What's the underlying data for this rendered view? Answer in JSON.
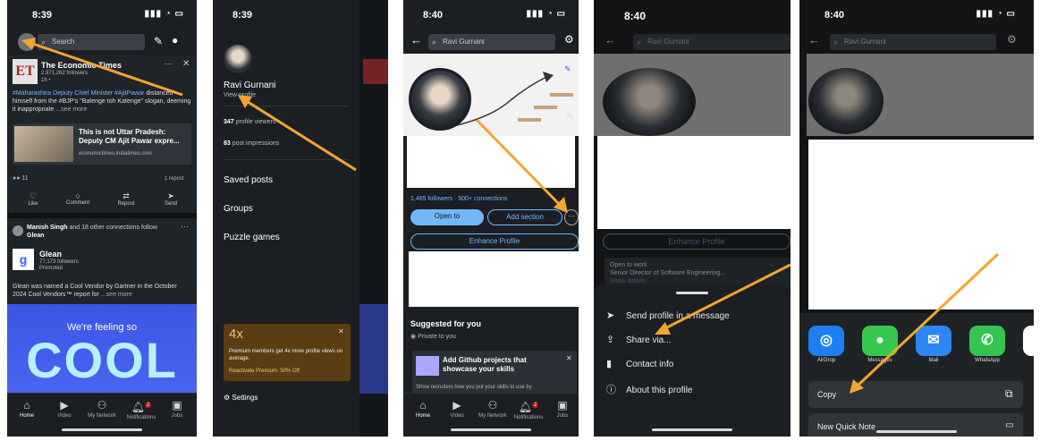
{
  "colors": {
    "bg": "#1b1f23",
    "accent": "#71b7fb",
    "arrow": "#f5a52a",
    "premium": "#5a3d12"
  },
  "s1": {
    "time": "8:39",
    "search_placeholder": "Search",
    "post1": {
      "source": "The Economic Times",
      "followers": "2,971,262 followers",
      "age": "1h •",
      "text_tags": "#Maharashtra Deputy Chief Minister #AjitPawar",
      "text_rest": "distanced himself from the #BJP's \"Batenge toh Katenge\" slogan, deeming it inappropriate",
      "more": "...see more",
      "link_title": "This is not Uttar Pradesh: Deputy CM Ajit Pawar expre...",
      "link_url": "economictimes.indiatimes.com",
      "reactions": "11",
      "reposts": "1 repost"
    },
    "actions": [
      "Like",
      "Comment",
      "Repost",
      "Send"
    ],
    "post2": {
      "header_name": "Manish Singh",
      "header_rest": "and 18 other connections follow",
      "header_company": "Glean",
      "company": "Glean",
      "followers": "77,173 followers",
      "promoted": "Promoted",
      "text": "Glean was named a Cool Vendor by Gartner in the October 2024 Cool Vendors™ report for",
      "more": "...see more",
      "banner_line1": "We're feeling so",
      "banner_line2": "COOL"
    },
    "nav": [
      "Home",
      "Video",
      "My Network",
      "Notifications",
      "Jobs"
    ],
    "notif_count": "2"
  },
  "s2": {
    "time": "8:39",
    "name": "Ravi Gurnani",
    "view_profile": "View profile",
    "stat1_num": "347",
    "stat1_label": "profile viewers",
    "stat2_num": "83",
    "stat2_label": "post impressions",
    "menu": [
      "Saved posts",
      "Groups",
      "Puzzle games"
    ],
    "premium": {
      "title": "4x",
      "text": "Premium members get 4x more profile views on average.",
      "cta": "Reactivate Premium: 50% Off"
    },
    "settings": "Settings"
  },
  "s3": {
    "time": "8:40",
    "search_value": "Ravi Gurnani",
    "followers": "1,485 followers",
    "connections": "500+ connections",
    "open_to": "Open to",
    "add_section": "Add section",
    "enhance": "Enhance Profile",
    "suggested_title": "Suggested for you",
    "private": "Private to you",
    "suggest_card_title": "Add Github projects that showcase your skills",
    "suggest_card_text": "Show recruiters how you put your skills to use by",
    "nav": [
      "Home",
      "Video",
      "My Network",
      "Notifications",
      "Jobs"
    ],
    "notif_count": "2"
  },
  "s4": {
    "time": "8:40",
    "search_value": "Ravi Gurnani",
    "enhance": "Enhance Profile",
    "open_to_work": "Open to work",
    "open_to_role": "Senior Director of Software Engineering...",
    "show_details": "Show details",
    "menu": [
      "Send profile in a message",
      "Share via...",
      "Contact info",
      "About this profile"
    ]
  },
  "s5": {
    "time": "8:40",
    "search_value": "Ravi Gurnani",
    "apps": [
      "AirDrop",
      "Messages",
      "Mail",
      "WhatsApp"
    ],
    "copy": "Copy",
    "new_quick_note": "New Quick Note"
  }
}
